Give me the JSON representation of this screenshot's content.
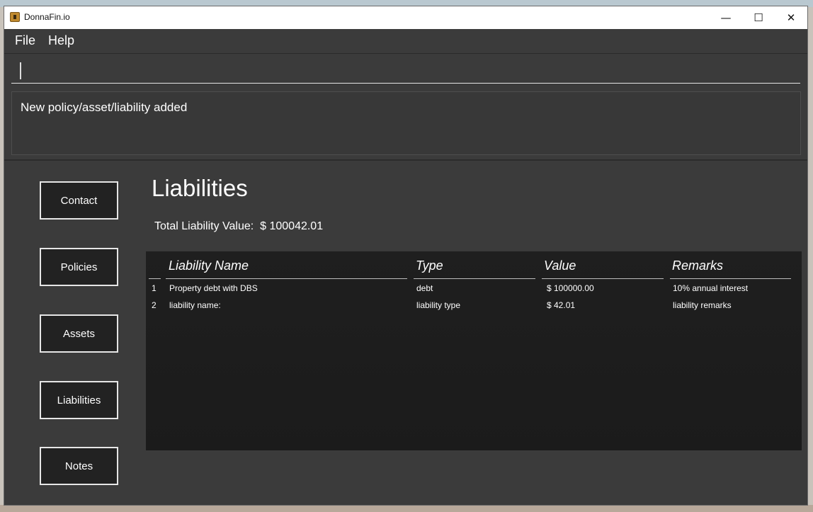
{
  "window": {
    "title": "DonnaFin.io"
  },
  "window_controls": {
    "minimize": "—",
    "maximize": "☐",
    "close": "✕"
  },
  "menu": {
    "items": [
      "File",
      "Help"
    ]
  },
  "command": {
    "value": ""
  },
  "result": {
    "message": "New policy/asset/liability added"
  },
  "nav": {
    "items": [
      "Contact",
      "Policies",
      "Assets",
      "Liabilities",
      "Notes"
    ]
  },
  "page": {
    "title": "Liabilities",
    "total_label": "Total Liability Value:",
    "total_value": "$ 100042.01"
  },
  "table": {
    "headers": [
      "Liability Name",
      "Type",
      "Value",
      "Remarks"
    ],
    "rows": [
      {
        "index": "1",
        "name": "Property debt with DBS",
        "type": "debt",
        "value": "$ 100000.00",
        "remarks": "10% annual interest"
      },
      {
        "index": "2",
        "name": "liability name:",
        "type": "liability type",
        "value": "$ 42.01",
        "remarks": "liability remarks"
      }
    ]
  }
}
